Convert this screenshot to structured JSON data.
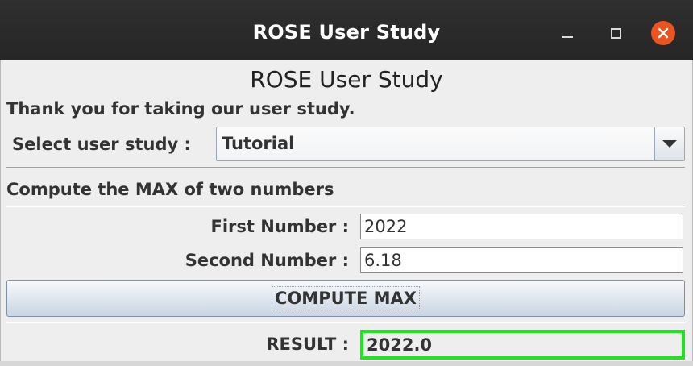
{
  "window": {
    "title": "ROSE User Study",
    "controls": {
      "minimize": "minimize",
      "maximize": "maximize",
      "close": "close"
    }
  },
  "app": {
    "heading": "ROSE User Study",
    "thanks_text": "Thank you for taking our user study.",
    "study_select": {
      "label": "Select user study :",
      "selected": "Tutorial"
    },
    "task_heading": "Compute the MAX of two numbers",
    "first_number": {
      "label": "First Number :",
      "value": "2022"
    },
    "second_number": {
      "label": "Second Number :",
      "value": "6.18"
    },
    "compute_button": "COMPUTE MAX",
    "result": {
      "label": "RESULT :",
      "value": "2022.0",
      "highlight_color": "#22e322"
    }
  },
  "icons": {
    "minimize": "minimize-icon",
    "maximize": "maximize-icon",
    "close": "close-icon",
    "dropdown": "chevron-down-icon"
  },
  "colors": {
    "close_button": "#e95420",
    "titlebar": "#2c2c2c"
  }
}
